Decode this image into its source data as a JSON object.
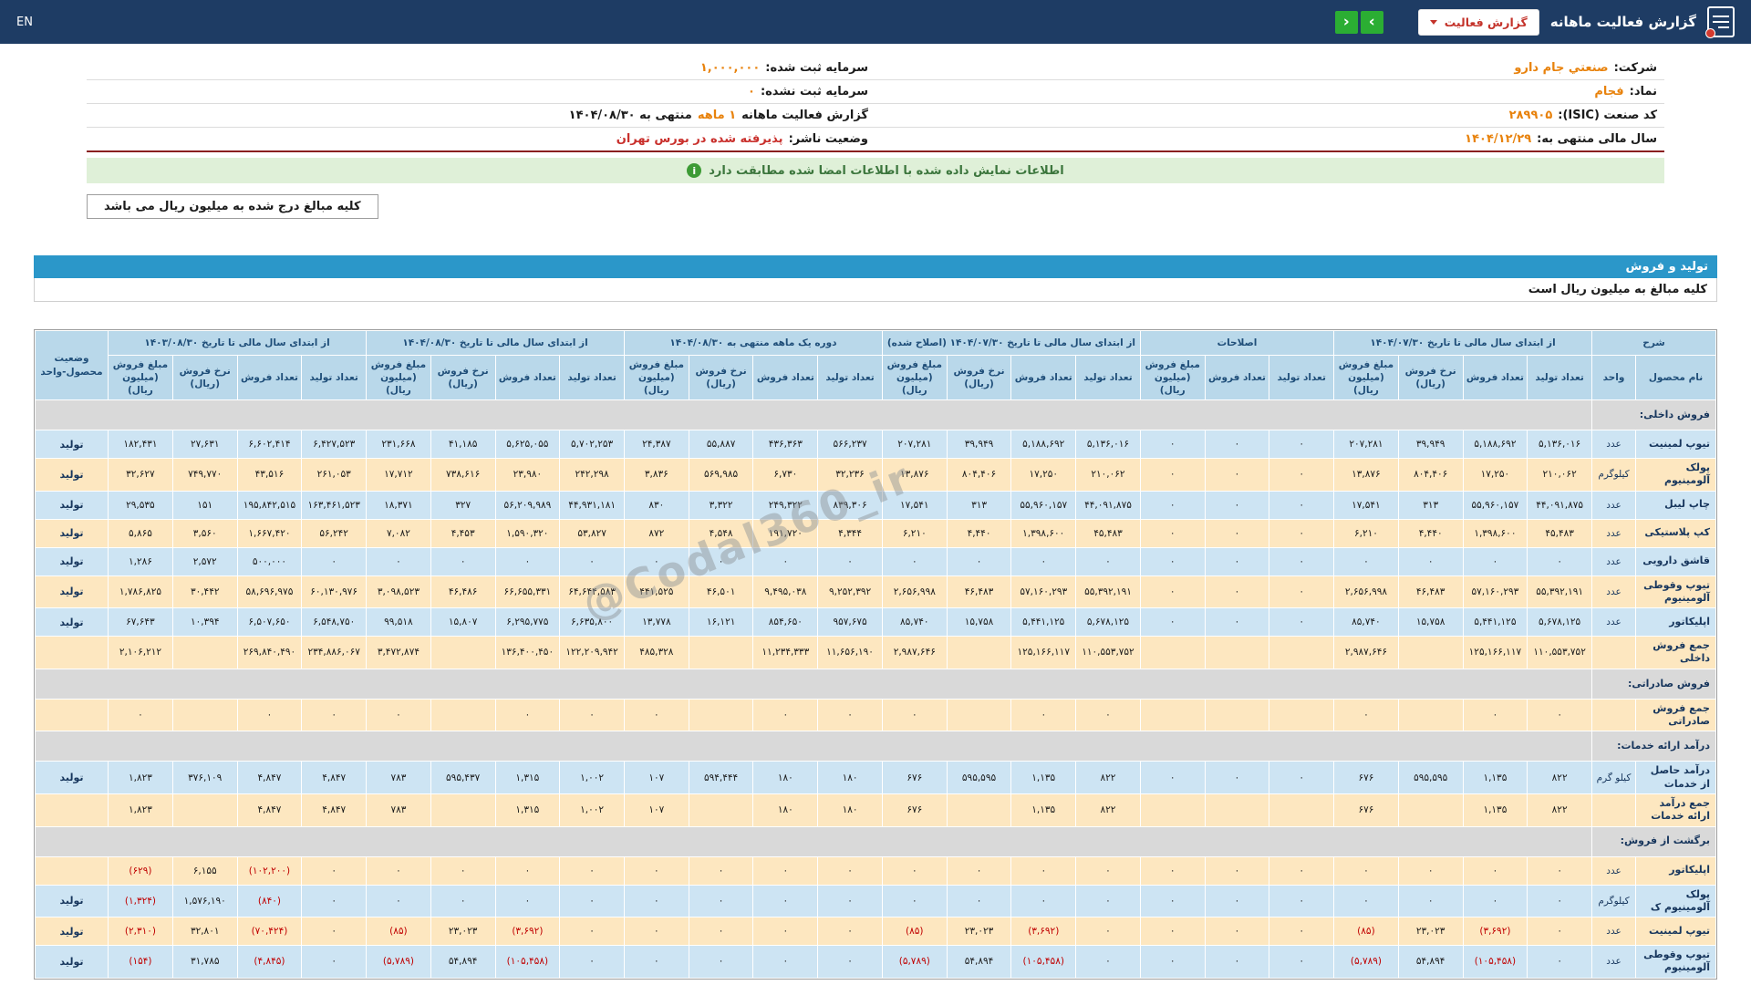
{
  "navbar": {
    "title": "گزارش فعالیت ماهانه",
    "dropdown_label": "گزارش فعالیت",
    "lang": "EN",
    "prev_icon": "‹",
    "next_icon": "›"
  },
  "company": {
    "rows": [
      {
        "r_label": "شرکت:",
        "r_value": "صنعتي جام دارو",
        "l_label": "سرمایه ثبت شده:",
        "l_value": "۱,۰۰۰,۰۰۰"
      },
      {
        "r_label": "نماد:",
        "r_value": "فجام",
        "l_label": "سرمایه ثبت نشده:",
        "l_value": "۰"
      },
      {
        "r_label": "کد صنعت (ISIC):",
        "r_value": "۲۸۹۹۰۵",
        "l_label": "گزارش فعالیت ماهانه",
        "l_value": "۱ ماهه",
        "l_suffix": "منتهی به ۱۴۰۴/۰۸/۳۰"
      },
      {
        "r_label": "سال مالی منتهی به:",
        "r_value": "۱۴۰۴/۱۲/۲۹",
        "l_label": "وضعیت ناشر:",
        "l_value": "پذیرفته شده در بورس تهران"
      }
    ]
  },
  "banner": {
    "text": "اطلاعات نمایش داده شده با اطلاعات امضا شده مطابقت دارد",
    "icon_glyph": "i"
  },
  "amounts_note": "کلیه مبالغ درج شده به میلیون ریال می باشد",
  "section": {
    "title": "تولید و فروش",
    "note": "کلیه مبالغ به میلیون ریال است"
  },
  "watermark": "@Codal360_ir",
  "colors": {
    "navbar": "#1e3c64",
    "accent_green": "#2bae33",
    "accent_red": "#c4332b",
    "value_orange": "#e8820c",
    "banner_green": "#dff0d8",
    "section_blue": "#2b97c9",
    "header_blue": "#b9d8ea",
    "row_blue": "#cde4f3",
    "row_cream": "#fde7c0",
    "row_gray": "#d9d9d9",
    "negative_red": "#c00000"
  },
  "table": {
    "groups": [
      {
        "label": "شرح",
        "cols": [
          "نام محصول",
          "واحد"
        ]
      },
      {
        "label": "از ابتدای سال مالی تا تاریخ ۱۴۰۴/۰۷/۳۰",
        "cols": [
          "تعداد تولید",
          "تعداد فروش",
          "نرخ فروش (ریال)",
          "مبلغ فروش (میلیون ریال)"
        ]
      },
      {
        "label": "اصلاحات",
        "cols": [
          "تعداد تولید",
          "تعداد فروش",
          "مبلغ فروش (میلیون ریال)"
        ]
      },
      {
        "label": "از ابتدای سال مالی تا تاریخ ۱۴۰۴/۰۷/۳۰ (اصلاح شده)",
        "cols": [
          "تعداد تولید",
          "تعداد فروش",
          "نرخ فروش (ریال)",
          "مبلغ فروش (میلیون ریال)"
        ]
      },
      {
        "label": "دوره یک ماهه منتهی به ۱۴۰۴/۰۸/۳۰",
        "cols": [
          "تعداد تولید",
          "تعداد فروش",
          "نرخ فروش (ریال)",
          "مبلغ فروش (میلیون ریال)"
        ]
      },
      {
        "label": "از ابتدای سال مالی تا تاریخ ۱۴۰۴/۰۸/۳۰",
        "cols": [
          "تعداد تولید",
          "تعداد فروش",
          "نرخ فروش (ریال)",
          "مبلغ فروش (میلیون ریال)"
        ]
      },
      {
        "label": "از ابتدای سال مالی تا تاریخ ۱۴۰۳/۰۸/۳۰",
        "cols": [
          "تعداد تولید",
          "تعداد فروش",
          "نرخ فروش (ریال)",
          "مبلغ فروش (میلیون ریال)"
        ]
      },
      {
        "label": "وضعیت محصول-واحد",
        "cols": []
      }
    ],
    "rows": [
      {
        "type": "section",
        "name": "فروش داخلی:"
      },
      {
        "type": "data",
        "variant": "blue",
        "name": "تیوپ لمینیت",
        "unit": "عدد",
        "status": "تولید",
        "values": [
          "۵,۱۳۶,۰۱۶",
          "۵,۱۸۸,۶۹۲",
          "۳۹,۹۴۹",
          "۲۰۷,۲۸۱",
          "۰",
          "۰",
          "۰",
          "۵,۱۳۶,۰۱۶",
          "۵,۱۸۸,۶۹۲",
          "۳۹,۹۴۹",
          "۲۰۷,۲۸۱",
          "۵۶۶,۲۳۷",
          "۴۳۶,۳۶۳",
          "۵۵,۸۸۷",
          "۲۴,۳۸۷",
          "۵,۷۰۲,۲۵۳",
          "۵,۶۲۵,۰۵۵",
          "۴۱,۱۸۵",
          "۲۳۱,۶۶۸",
          "۶,۴۲۷,۵۲۳",
          "۶,۶۰۲,۴۱۴",
          "۲۷,۶۳۱",
          "۱۸۲,۴۳۱"
        ]
      },
      {
        "type": "data",
        "variant": "cream",
        "name": "پولک آلومینیوم",
        "unit": "کیلوگرم",
        "status": "تولید",
        "values": [
          "۲۱۰,۰۶۲",
          "۱۷,۲۵۰",
          "۸۰۴,۴۰۶",
          "۱۳,۸۷۶",
          "۰",
          "۰",
          "۰",
          "۲۱۰,۰۶۲",
          "۱۷,۲۵۰",
          "۸۰۴,۴۰۶",
          "۱۳,۸۷۶",
          "۳۲,۲۳۶",
          "۶,۷۳۰",
          "۵۶۹,۹۸۵",
          "۳,۸۳۶",
          "۲۴۲,۲۹۸",
          "۲۳,۹۸۰",
          "۷۳۸,۶۱۶",
          "۱۷,۷۱۲",
          "۲۶۱,۰۵۳",
          "۴۳,۵۱۶",
          "۷۴۹,۷۷۰",
          "۳۲,۶۲۷"
        ]
      },
      {
        "type": "data",
        "variant": "blue",
        "name": "چاپ لیبل",
        "unit": "عدد",
        "status": "تولید",
        "values": [
          "۴۴,۰۹۱,۸۷۵",
          "۵۵,۹۶۰,۱۵۷",
          "۳۱۳",
          "۱۷,۵۴۱",
          "۰",
          "۰",
          "۰",
          "۴۴,۰۹۱,۸۷۵",
          "۵۵,۹۶۰,۱۵۷",
          "۳۱۳",
          "۱۷,۵۴۱",
          "۸۳۹,۳۰۶",
          "۲۴۹,۳۲۲",
          "۳,۳۲۲",
          "۸۳۰",
          "۴۴,۹۳۱,۱۸۱",
          "۵۶,۲۰۹,۹۸۹",
          "۳۲۷",
          "۱۸,۳۷۱",
          "۱۶۳,۴۶۱,۵۲۳",
          "۱۹۵,۸۴۲,۵۱۵",
          "۱۵۱",
          "۲۹,۵۳۵"
        ]
      },
      {
        "type": "data",
        "variant": "cream",
        "name": "کپ پلاستیکی",
        "unit": "عدد",
        "status": "تولید",
        "values": [
          "۴۵,۴۸۳",
          "۱,۳۹۸,۶۰۰",
          "۴,۴۴۰",
          "۶,۲۱۰",
          "۰",
          "۰",
          "۰",
          "۴۵,۴۸۳",
          "۱,۳۹۸,۶۰۰",
          "۴,۴۴۰",
          "۶,۲۱۰",
          "۴,۳۴۴",
          "۱۹۱,۷۲۰",
          "۴,۵۴۸",
          "۸۷۲",
          "۵۳,۸۲۷",
          "۱,۵۹۰,۳۲۰",
          "۴,۴۵۳",
          "۷,۰۸۲",
          "۵۶,۲۴۲",
          "۱,۶۶۷,۴۲۰",
          "۳,۵۶۰",
          "۵,۸۶۵"
        ]
      },
      {
        "type": "data",
        "variant": "blue",
        "name": "قاشق دارویی",
        "unit": "عدد",
        "status": "تولید",
        "values": [
          "۰",
          "۰",
          "۰",
          "۰",
          "۰",
          "۰",
          "۰",
          "۰",
          "۰",
          "۰",
          "۰",
          "۰",
          "۰",
          "۰",
          "۰",
          "۰",
          "۰",
          "۰",
          "۰",
          "۰",
          "۵۰۰,۰۰۰",
          "۲,۵۷۲",
          "۱,۲۸۶"
        ]
      },
      {
        "type": "data",
        "variant": "cream",
        "name": "تیوپ وقوطی آلومینیوم",
        "unit": "عدد",
        "status": "تولید",
        "values": [
          "۵۵,۳۹۲,۱۹۱",
          "۵۷,۱۶۰,۲۹۳",
          "۴۶,۴۸۳",
          "۲,۶۵۶,۹۹۸",
          "۰",
          "۰",
          "۰",
          "۵۵,۳۹۲,۱۹۱",
          "۵۷,۱۶۰,۲۹۳",
          "۴۶,۴۸۳",
          "۲,۶۵۶,۹۹۸",
          "۹,۲۵۲,۳۹۲",
          "۹,۴۹۵,۰۳۸",
          "۴۶,۵۰۱",
          "۴۴۱,۵۲۵",
          "۶۴,۶۴۴,۵۸۳",
          "۶۶,۶۵۵,۳۳۱",
          "۴۶,۴۸۶",
          "۳,۰۹۸,۵۲۳",
          "۶۰,۱۳۰,۹۷۶",
          "۵۸,۶۹۶,۹۷۵",
          "۳۰,۴۴۲",
          "۱,۷۸۶,۸۲۵"
        ]
      },
      {
        "type": "data",
        "variant": "blue",
        "name": "اپلیکاتور",
        "unit": "عدد",
        "status": "تولید",
        "values": [
          "۵,۶۷۸,۱۲۵",
          "۵,۴۴۱,۱۲۵",
          "۱۵,۷۵۸",
          "۸۵,۷۴۰",
          "۰",
          "۰",
          "۰",
          "۵,۶۷۸,۱۲۵",
          "۵,۴۴۱,۱۲۵",
          "۱۵,۷۵۸",
          "۸۵,۷۴۰",
          "۹۵۷,۶۷۵",
          "۸۵۴,۶۵۰",
          "۱۶,۱۲۱",
          "۱۳,۷۷۸",
          "۶,۶۳۵,۸۰۰",
          "۶,۲۹۵,۷۷۵",
          "۱۵,۸۰۷",
          "۹۹,۵۱۸",
          "۶,۵۴۸,۷۵۰",
          "۶,۵۰۷,۶۵۰",
          "۱۰,۳۹۴",
          "۶۷,۶۴۳"
        ]
      },
      {
        "type": "data",
        "variant": "total",
        "name": "جمع فروش داخلی",
        "unit": "",
        "status": "",
        "values": [
          "۱۱۰,۵۵۳,۷۵۲",
          "۱۲۵,۱۶۶,۱۱۷",
          "",
          "۲,۹۸۷,۶۴۶",
          "",
          "",
          "",
          "۱۱۰,۵۵۳,۷۵۲",
          "۱۲۵,۱۶۶,۱۱۷",
          "",
          "۲,۹۸۷,۶۴۶",
          "۱۱,۶۵۶,۱۹۰",
          "۱۱,۲۳۴,۳۳۳",
          "",
          "۴۸۵,۳۲۸",
          "۱۲۲,۲۰۹,۹۴۲",
          "۱۳۶,۴۰۰,۴۵۰",
          "",
          "۳,۴۷۲,۸۷۴",
          "۲۳۴,۸۸۶,۰۶۷",
          "۲۶۹,۸۴۰,۴۹۰",
          "",
          "۲,۱۰۶,۲۱۲"
        ]
      },
      {
        "type": "section",
        "name": "فروش صادراتی:"
      },
      {
        "type": "data",
        "variant": "total",
        "name": "جمع فروش صادراتی",
        "unit": "",
        "status": "",
        "values": [
          "۰",
          "۰",
          "",
          "۰",
          "",
          "",
          "",
          "۰",
          "۰",
          "",
          "۰",
          "۰",
          "۰",
          "",
          "۰",
          "۰",
          "۰",
          "",
          "۰",
          "۰",
          "۰",
          "",
          "۰"
        ]
      },
      {
        "type": "section",
        "name": "درآمد ارائه خدمات:"
      },
      {
        "type": "data",
        "variant": "blue",
        "name": "درآمد حاصل از خدمات",
        "unit": "کیلو گرم",
        "status": "تولید",
        "values": [
          "۸۲۲",
          "۱,۱۳۵",
          "۵۹۵,۵۹۵",
          "۶۷۶",
          "۰",
          "۰",
          "۰",
          "۸۲۲",
          "۱,۱۳۵",
          "۵۹۵,۵۹۵",
          "۶۷۶",
          "۱۸۰",
          "۱۸۰",
          "۵۹۴,۴۴۴",
          "۱۰۷",
          "۱,۰۰۲",
          "۱,۳۱۵",
          "۵۹۵,۴۳۷",
          "۷۸۳",
          "۴,۸۴۷",
          "۴,۸۴۷",
          "۳۷۶,۱۰۹",
          "۱,۸۲۳"
        ]
      },
      {
        "type": "data",
        "variant": "total",
        "name": "جمع درآمد ارائه خدمات",
        "unit": "",
        "status": "",
        "values": [
          "۸۲۲",
          "۱,۱۳۵",
          "",
          "۶۷۶",
          "",
          "",
          "",
          "۸۲۲",
          "۱,۱۳۵",
          "",
          "۶۷۶",
          "۱۸۰",
          "۱۸۰",
          "",
          "۱۰۷",
          "۱,۰۰۲",
          "۱,۳۱۵",
          "",
          "۷۸۳",
          "۴,۸۴۷",
          "۴,۸۴۷",
          "",
          "۱,۸۲۳"
        ]
      },
      {
        "type": "section",
        "name": "برگشت از فروش:"
      },
      {
        "type": "data",
        "variant": "cream",
        "name": "اپلیکاتور",
        "unit": "عدد",
        "status": "",
        "values": [
          "۰",
          "۰",
          "۰",
          "۰",
          "۰",
          "۰",
          "۰",
          "۰",
          "۰",
          "۰",
          "۰",
          "۰",
          "۰",
          "۰",
          "۰",
          "۰",
          "۰",
          "۰",
          "۰",
          "۰",
          "(۱۰۲,۲۰۰)",
          "۶,۱۵۵",
          "(۶۲۹)"
        ]
      },
      {
        "type": "data",
        "variant": "blue",
        "name": "پولک آلومینیوم ک",
        "unit": "کیلوگرم",
        "status": "تولید",
        "values": [
          "۰",
          "۰",
          "۰",
          "۰",
          "۰",
          "۰",
          "۰",
          "۰",
          "۰",
          "۰",
          "۰",
          "۰",
          "۰",
          "۰",
          "۰",
          "۰",
          "۰",
          "۰",
          "۰",
          "۰",
          "(۸۴۰)",
          "۱,۵۷۶,۱۹۰",
          "(۱,۳۲۴)"
        ]
      },
      {
        "type": "data",
        "variant": "cream",
        "name": "تیوپ لمینیت",
        "unit": "عدد",
        "status": "تولید",
        "values": [
          "۰",
          "(۳,۶۹۲)",
          "۲۳,۰۲۳",
          "(۸۵)",
          "۰",
          "۰",
          "۰",
          "۰",
          "(۳,۶۹۲)",
          "۲۳,۰۲۳",
          "(۸۵)",
          "۰",
          "۰",
          "۰",
          "۰",
          "۰",
          "(۳,۶۹۲)",
          "۲۳,۰۲۳",
          "(۸۵)",
          "۰",
          "(۷۰,۴۲۴)",
          "۳۲,۸۰۱",
          "(۲,۳۱۰)"
        ]
      },
      {
        "type": "data",
        "variant": "blue",
        "name": "تیوپ وقوطی آلومینیوم",
        "unit": "عدد",
        "status": "تولید",
        "values": [
          "۰",
          "(۱۰۵,۴۵۸)",
          "۵۴,۸۹۴",
          "(۵,۷۸۹)",
          "۰",
          "۰",
          "۰",
          "۰",
          "(۱۰۵,۴۵۸)",
          "۵۴,۸۹۴",
          "(۵,۷۸۹)",
          "۰",
          "۰",
          "۰",
          "۰",
          "۰",
          "(۱۰۵,۴۵۸)",
          "۵۴,۸۹۴",
          "(۵,۷۸۹)",
          "۰",
          "(۴,۸۴۵)",
          "۳۱,۷۸۵",
          "(۱۵۴)"
        ]
      }
    ]
  }
}
